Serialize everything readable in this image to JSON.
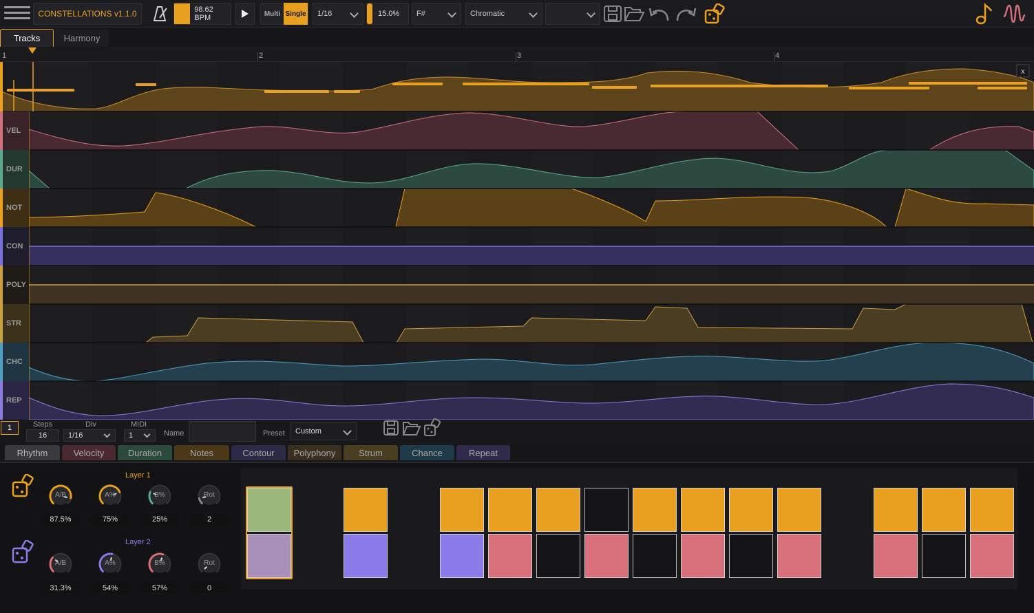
{
  "app": {
    "title": "CONSTELLATIONS v1.1.0"
  },
  "toolbar": {
    "bpm": "98.62 BPM",
    "mode_multi": "Multi",
    "mode_single": "Single",
    "division": "1/16",
    "swing": "15.0%",
    "key": "F#",
    "scale": "Chromatic",
    "preset_empty": ""
  },
  "tabs": [
    "Tracks",
    "Harmony"
  ],
  "ruler": {
    "bars": [
      "1",
      "2",
      "3",
      "4"
    ]
  },
  "tracks": [
    {
      "label": "",
      "color": "#e9a020"
    },
    {
      "label": "VEL",
      "color": "#d07080"
    },
    {
      "label": "DUR",
      "color": "#5fa890"
    },
    {
      "label": "NOT",
      "color": "#e9a020"
    },
    {
      "label": "CON",
      "color": "#7b6fe0"
    },
    {
      "label": "POLY",
      "color": "#c9a040"
    },
    {
      "label": "STR",
      "color": "#c9a040"
    },
    {
      "label": "CHC",
      "color": "#4f9ec0"
    },
    {
      "label": "REP",
      "color": "#8f7be0"
    }
  ],
  "close_button": "x",
  "params": {
    "track_number": "1",
    "steps_label": "Steps",
    "steps_value": "16",
    "div_label": "Div",
    "div_value": "1/16",
    "midi_label": "MIDI",
    "midi_value": "1",
    "name_label": "Name",
    "name_value": "",
    "preset_label": "Preset",
    "preset_value": "Custom"
  },
  "subtabs": [
    "Rhythm",
    "Velocity",
    "Duration",
    "Notes",
    "Contour",
    "Polyphony",
    "Strum",
    "Chance",
    "Repeat"
  ],
  "layers": [
    {
      "title": "Layer 1",
      "knobs": [
        {
          "name": "A/B",
          "value": "87.5%",
          "level": 0.875
        },
        {
          "name": "A%",
          "value": "75%",
          "level": 0.75
        },
        {
          "name": "B%",
          "value": "25%",
          "level": 0.25
        },
        {
          "name": "Rot",
          "value": "2",
          "level": 0.12
        }
      ]
    },
    {
      "title": "Layer 2",
      "knobs": [
        {
          "name": "A/B",
          "value": "31.3%",
          "level": 0.313
        },
        {
          "name": "A%",
          "value": "54%",
          "level": 0.54
        },
        {
          "name": "B%",
          "value": "57%",
          "level": 0.57
        },
        {
          "name": "Rot",
          "value": "0",
          "level": 0.0
        }
      ]
    }
  ],
  "pattern": {
    "top": [
      "green",
      "",
      "orange",
      "",
      "orange",
      "orange",
      "orange",
      "dark",
      "orange",
      "orange",
      "orange",
      "orange",
      "",
      "orange",
      "orange",
      "orange"
    ],
    "bottom": [
      "mauve",
      "",
      "violet",
      "",
      "violet",
      "pink",
      "dark",
      "pink",
      "dark",
      "pink",
      "dark",
      "pink",
      "",
      "pink",
      "dark",
      "pink"
    ]
  },
  "colors": {
    "accent": "#e9a020",
    "pink": "#d8707c",
    "violet": "#8b7be8",
    "green": "#9bb77a",
    "mauve": "#a890b8"
  }
}
